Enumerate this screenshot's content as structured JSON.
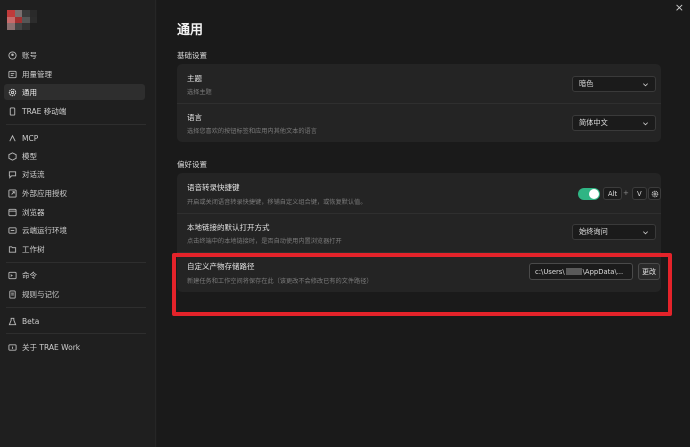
{
  "sidebar": {
    "items": [
      {
        "label": "账号",
        "icon": "account-icon"
      },
      {
        "label": "用量管理",
        "icon": "usage-icon"
      },
      {
        "label": "通用",
        "icon": "gear-icon",
        "active": true
      },
      {
        "label": "TRAE 移动端",
        "icon": "mobile-icon"
      },
      {
        "label": "MCP",
        "icon": "mcp-icon"
      },
      {
        "label": "模型",
        "icon": "model-icon"
      },
      {
        "label": "对话流",
        "icon": "dialog-flow-icon"
      },
      {
        "label": "外部应用授权",
        "icon": "external-auth-icon"
      },
      {
        "label": "浏览器",
        "icon": "browser-icon"
      },
      {
        "label": "云端运行环境",
        "icon": "cloud-icon"
      },
      {
        "label": "工作树",
        "icon": "worktree-icon"
      },
      {
        "label": "命令",
        "icon": "command-icon"
      },
      {
        "label": "规则与记忆",
        "icon": "rules-icon"
      },
      {
        "label": "Beta",
        "icon": "beta-icon"
      },
      {
        "label": "关于 TRAE Work",
        "icon": "about-icon"
      }
    ]
  },
  "main": {
    "title": "通用",
    "close_glyph": "×",
    "basic": {
      "section_title": "基础设置",
      "theme": {
        "label": "主题",
        "desc": "选择主题",
        "value": "暗色"
      },
      "language": {
        "label": "语言",
        "desc": "选择您喜欢的按钮标签和应用内其他文本的语言",
        "value": "简体中文"
      }
    },
    "prefs": {
      "section_title": "偏好设置",
      "voice": {
        "label": "语音转录快捷键",
        "desc": "开启或关闭语音转录快捷键，移铺自定义组合键，或恢复默认值。",
        "key1": "Alt",
        "plus": "+",
        "key2": "V",
        "enabled": true
      },
      "local_link": {
        "label": "本地链接的默认打开方式",
        "desc": "点击终端中的本地链接时，是否自动使用内置浏览器打开",
        "value": "始终询问"
      },
      "storage": {
        "label": "自定义产物存储路径",
        "desc": "新建任务和工作空间将保存在此（该更改不会修改已有的文件路径）",
        "path_prefix": "c:\\Users\\",
        "path_suffix": "\\AppData\\...",
        "button": "更改"
      }
    }
  },
  "colors": {
    "accent_toggle": "#2fb584",
    "highlight": "#e4232a"
  }
}
